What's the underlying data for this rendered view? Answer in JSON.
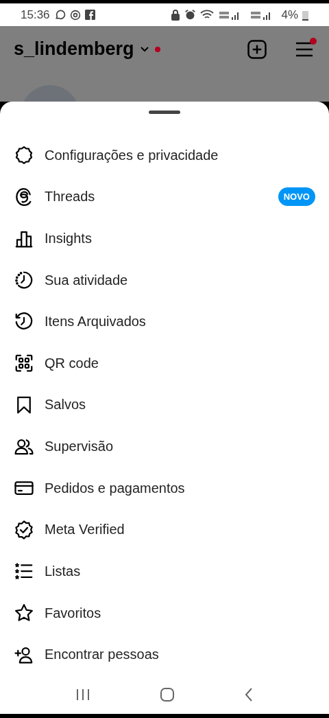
{
  "status_bar": {
    "time": "15:36",
    "battery": "4%"
  },
  "header": {
    "username": "s_lindemberg",
    "has_notification": true,
    "menu_notification": true
  },
  "menu": {
    "items": [
      {
        "label": "Configurações e privacidade"
      },
      {
        "label": "Threads",
        "badge": "NOVO"
      },
      {
        "label": "Insights"
      },
      {
        "label": "Sua atividade"
      },
      {
        "label": "Itens Arquivados"
      },
      {
        "label": "QR code"
      },
      {
        "label": "Salvos"
      },
      {
        "label": "Supervisão"
      },
      {
        "label": "Pedidos e pagamentos"
      },
      {
        "label": "Meta Verified"
      },
      {
        "label": "Listas"
      },
      {
        "label": "Favoritos"
      },
      {
        "label": "Encontrar pessoas"
      }
    ]
  }
}
